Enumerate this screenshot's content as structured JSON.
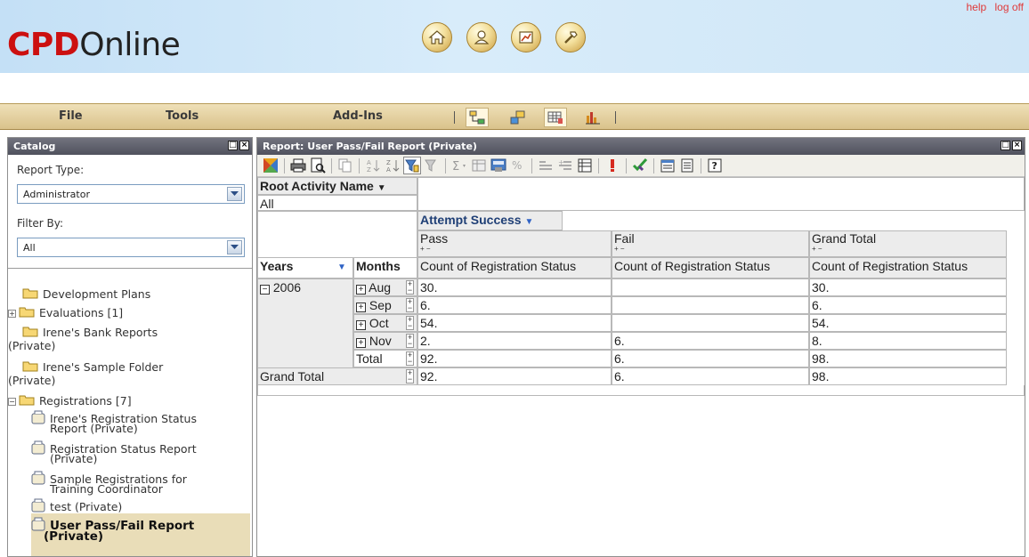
{
  "header": {
    "logo_bold": "CPD",
    "logo_light": "Online",
    "help_link": "help",
    "logoff_link": "log off",
    "nav_icons": [
      "home-icon",
      "user-icon",
      "chart-icon",
      "hammer-icon"
    ]
  },
  "menubar": {
    "file": "File",
    "tools": "Tools",
    "addins": "Add-Ins",
    "toolbar_icons": [
      "hierarchy-icon",
      "arrows-icon",
      "grid-icon",
      "bar-chart-icon"
    ]
  },
  "catalog": {
    "title": "Catalog",
    "report_type_label": "Report Type:",
    "report_type_value": "Administrator",
    "filter_by_label": "Filter By:",
    "filter_by_value": "All",
    "tree": [
      {
        "label": "Development Plans",
        "type": "folder"
      },
      {
        "label": "Evaluations [1]",
        "type": "folder",
        "expander": "+"
      },
      {
        "label": "Irene's Bank Reports",
        "label2": "(Private)",
        "type": "folder"
      },
      {
        "label": "Irene's Sample Folder",
        "label2": "(Private)",
        "type": "folder"
      },
      {
        "label": "Registrations [7]",
        "type": "folder",
        "expander": "−"
      },
      {
        "label": "Irene's Registration Status",
        "label2": "Report (Private)",
        "type": "report"
      },
      {
        "label": "Registration Status Report",
        "label2": "(Private)",
        "type": "report"
      },
      {
        "label": "Sample Registrations for",
        "label2": "Training Coordinator",
        "type": "report"
      },
      {
        "label": "test (Private)",
        "type": "report"
      },
      {
        "label": "User Pass/Fail Report",
        "label2": "(Private)",
        "type": "report",
        "selected": true
      }
    ]
  },
  "report": {
    "title": "Report: User Pass/Fail Report (Private)",
    "filter_field": "Root Activity Name",
    "filter_value": "All",
    "column_field": "Attempt Success",
    "columns": [
      "Pass",
      "Fail",
      "Grand Total"
    ],
    "measure": "Count of Registration Status",
    "row_field_1": "Years",
    "row_field_2": "Months",
    "year": "2006",
    "rows": [
      {
        "month": "Aug",
        "pass": "30.",
        "fail": "",
        "total": "30."
      },
      {
        "month": "Sep",
        "pass": "6.",
        "fail": "",
        "total": "6."
      },
      {
        "month": "Oct",
        "pass": "54.",
        "fail": "",
        "total": "54."
      },
      {
        "month": "Nov",
        "pass": "2.",
        "fail": "6.",
        "total": "8."
      }
    ],
    "subtotal_label": "Total",
    "subtotal": {
      "pass": "92.",
      "fail": "6.",
      "total": "98."
    },
    "grand_total_label": "Grand Total",
    "grand_total": {
      "pass": "92.",
      "fail": "6.",
      "total": "98."
    }
  }
}
